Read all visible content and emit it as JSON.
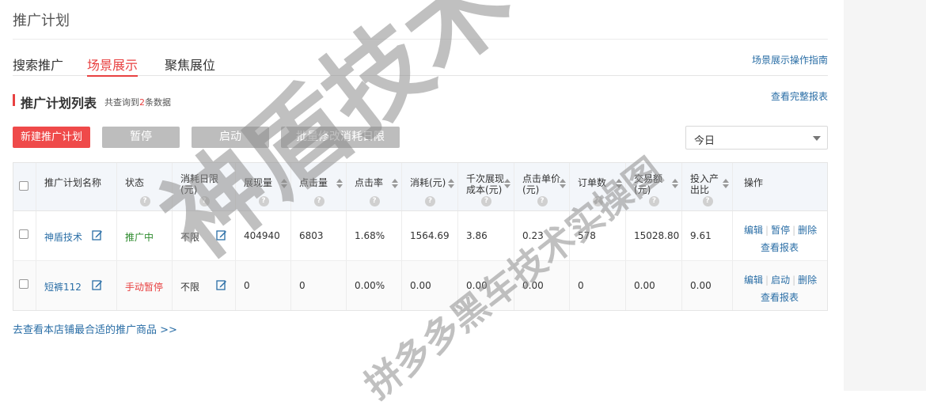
{
  "header": {
    "title": "推广计划"
  },
  "tabs": [
    {
      "label": "搜索推广"
    },
    {
      "label": "场景展示"
    },
    {
      "label": "聚焦展位"
    }
  ],
  "links": {
    "guide": "场景展示操作指南",
    "full_report": "查看完整报表",
    "bottom": "去查看本店铺最合适的推广商品 >>"
  },
  "section": {
    "title": "推广计划列表",
    "count_prefix": "共查询到",
    "count_num": "2",
    "count_suffix": "条数据"
  },
  "buttons": {
    "new_plan": "新建推广计划",
    "pause": "暂停",
    "start": "启动",
    "batch_limit": "批量修改消耗日限"
  },
  "date_select": {
    "value": "今日"
  },
  "table": {
    "headers": {
      "name": "推广计划名称",
      "status": "状态",
      "daily_limit": "消耗日限(元)",
      "impressions": "展现量",
      "clicks": "点击量",
      "ctr": "点击率",
      "cost": "消耗(元)",
      "cpm": "千次展现成本(元)",
      "cpc": "点击单价(元)",
      "orders": "订单数",
      "gmv": "交易额(元)",
      "roi": "投入产出比",
      "actions": "操作"
    },
    "rows": [
      {
        "name": "神盾技术",
        "status": "推广中",
        "daily_limit": "不限",
        "impressions": "404940",
        "clicks": "6803",
        "ctr": "1.68%",
        "cost": "1564.69",
        "cpm": "3.86",
        "cpc": "0.23",
        "orders": "578",
        "gmv": "15028.80",
        "roi": "9.61",
        "op_edit": "编辑",
        "op_toggle": "暂停",
        "op_delete": "删除",
        "op_report": "查看报表"
      },
      {
        "name": "短裤112",
        "status": "手动暂停",
        "daily_limit": "不限",
        "impressions": "0",
        "clicks": "0",
        "ctr": "0.00%",
        "cost": "0.00",
        "cpm": "0.00",
        "cpc": "0.00",
        "orders": "0",
        "gmv": "0.00",
        "roi": "0.00",
        "op_edit": "编辑",
        "op_toggle": "启动",
        "op_delete": "删除",
        "op_report": "查看报表"
      }
    ]
  },
  "watermark": {
    "main": "神盾技术",
    "sub": "拼多多黑车技术实操图"
  },
  "colors": {
    "accent": "#e84141",
    "link": "#2a6ea6",
    "active_status": "#2e8b2e",
    "button_gray": "#bdbdbd"
  },
  "icons": {
    "edit": "edit-icon",
    "help": "question-circle-icon",
    "sort": "sort-icon",
    "caret": "chevron-down-icon"
  }
}
